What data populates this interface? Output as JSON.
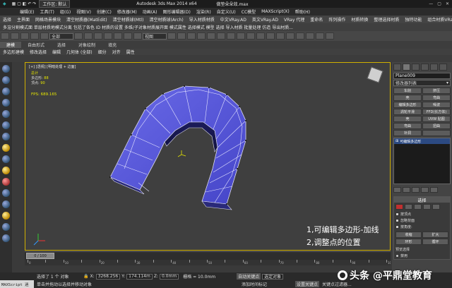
{
  "titlebar": {
    "workspace": "工作区: 默认",
    "app_title": "Autodesk 3ds Max  2014 x64",
    "file_name": "做垫朵朵效.max"
  },
  "menubar": [
    "编辑(E)",
    "工具(T)",
    "组(G)",
    "视图(V)",
    "创建(C)",
    "修改器(M)",
    "动画(A)",
    "图形编辑器(D)",
    "渲染(R)",
    "自定义(U)",
    "CC模型",
    "MAXScript(X)",
    "帮助(H)"
  ],
  "row1": [
    "选择",
    "主界面",
    "网格场景模块",
    "清空材质器(MatEdit)",
    "清空材质球(Mtl)",
    "清空材质球(Arch)",
    "导入材质材质",
    "中文VRay.AD",
    "英文VRay.AD",
    "VRay 代理",
    "重命名",
    "阵列操作",
    "材质转换",
    "整理选择材质",
    "独特功能",
    "组合材质VRayMtl"
  ],
  "row2": "多渲分割模式面 单层材质地模式分离 包括了各色 ID 材质的设置 多维/子对象材质展开面 模式属性 选择模式 模型 选择 导入材质 批量处理 仿造 导出材质...",
  "row3": {
    "dropdown1": "全部",
    "dropdown2": "视图"
  },
  "ribbon": {
    "tabs": [
      "建模",
      "自由形式",
      "选择",
      "对象绘制",
      "填充"
    ]
  },
  "subribbon": [
    "多边形建模",
    "修改选择",
    "编辑",
    "几何体 (全部)",
    "细分",
    "对齐",
    "属性"
  ],
  "viewport": {
    "label": "[+] [透视] [明暗处理 + 边面]",
    "stats_total": "总计",
    "stats_polys_label": "多边形:",
    "stats_polys": "88",
    "stats_verts_label": "顶点:",
    "stats_verts": "90",
    "fps_label": "FPS:",
    "fps": "689.165",
    "overlay_line1": "1,可编辑多边形-加线",
    "overlay_line2": "2,调整点的位置"
  },
  "right_panel": {
    "object_name": "Plane009",
    "modifier_list": "修改器列表",
    "buttons": [
      "车削",
      "挤压",
      "壳",
      "弯曲",
      "编辑多边形",
      "噪波",
      "涡轮平滑",
      "FFD(长方体)",
      "壳",
      "UVW 贴图",
      "弯曲",
      "扭曲",
      "补洞",
      ""
    ],
    "stack_item": "可编辑多边形",
    "selection_title": "选择",
    "check1": "按顶点",
    "check2": "忽略背面",
    "check3": "按角度:",
    "shrink": "收缩",
    "grow": "扩大",
    "ring": "环形",
    "loop": "循环",
    "preview": "预览选择",
    "disabled": "禁用"
  },
  "timeline": {
    "thumb": "0 / 100"
  },
  "ruler_labels": [
    "0",
    "10",
    "20",
    "30",
    "40",
    "50",
    "60",
    "70",
    "80",
    "90",
    "100"
  ],
  "status": {
    "selected": "选择了 1 个 对象",
    "hint": "单击并拖动以选择并移动对象",
    "x_label": "X:",
    "x_val": "3268.256",
    "y_label": "Y:",
    "y_val": "174.114m",
    "z_label": "Z:",
    "z_val": "0.0mm",
    "grid": "栅格 = 10.0mm",
    "autokey": "自动关键点",
    "selected_obj": "选定对象",
    "set_key": "设置关键点",
    "filter": "关键点过滤器...",
    "add_time_tag": "添加时间标记"
  },
  "maxscript": "MAXScript 迷",
  "watermark": "头条 @平鼎堂教育"
}
